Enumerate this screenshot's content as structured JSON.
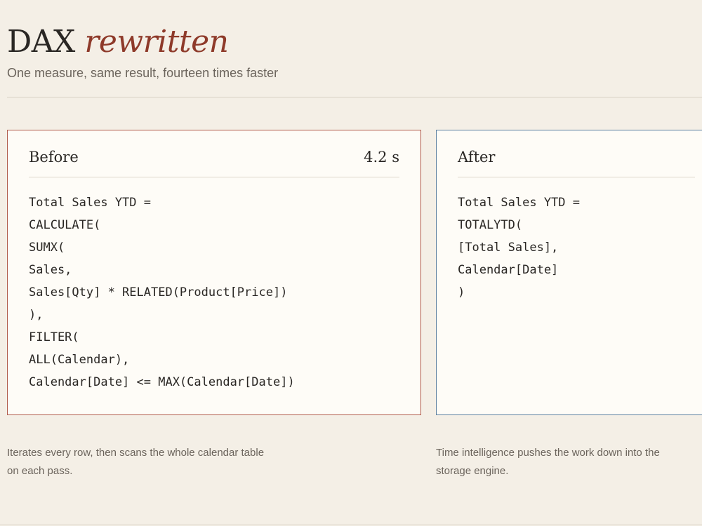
{
  "header": {
    "title_plain": "DAX ",
    "title_accent": "rewritten",
    "subtitle": "One measure, same result, fourteen times faster"
  },
  "before": {
    "label": "Before",
    "time": "4.2 s",
    "code": [
      "Total Sales YTD =",
      "CALCULATE(",
      "SUMX(",
      "Sales,",
      "Sales[Qty] * RELATED(Product[Price])",
      "),",
      "FILTER(",
      "ALL(Calendar),",
      "Calendar[Date] <= MAX(Calendar[Date])"
    ],
    "note": "Iterates every row, then scans the whole calendar table on each pass."
  },
  "after": {
    "label": "After",
    "code": [
      "Total Sales YTD =",
      "TOTALYTD(",
      "[Total Sales],",
      "Calendar[Date]",
      ")"
    ],
    "note": "Time intelligence pushes the work down into the storage engine."
  },
  "colors": {
    "accent": "#8e3a2a",
    "before_border": "#b05a4a",
    "after_border": "#5a7fa0",
    "background": "#f4efe6",
    "panel": "#fefcf7"
  }
}
